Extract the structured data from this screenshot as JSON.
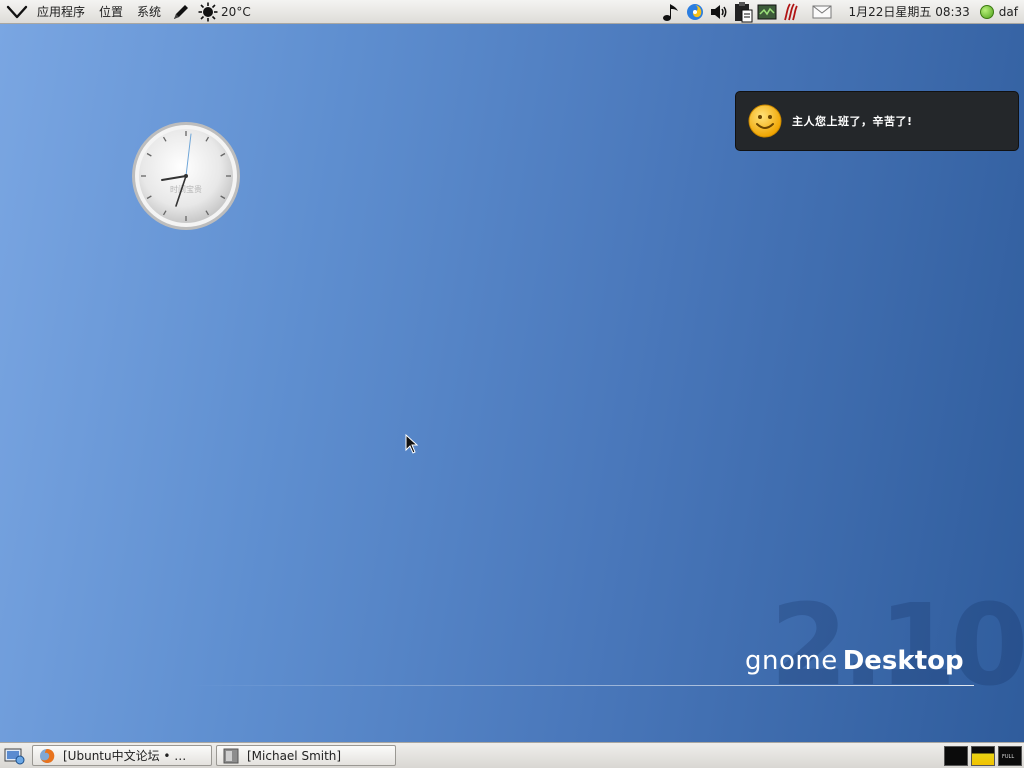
{
  "top_panel": {
    "menus": [
      {
        "label": "应用程序"
      },
      {
        "label": "位置"
      },
      {
        "label": "系统"
      }
    ],
    "weather": {
      "icon": "sun-icon",
      "temperature": "20°C"
    },
    "datetime": "1月22日星期五 08:33",
    "username": "daf",
    "status_color": "#5fb52a"
  },
  "clock_widget": {
    "brand_text": "时间宝贵"
  },
  "notification": {
    "message": "主人您上班了，辛苦了!"
  },
  "branding": {
    "version": "2.10",
    "word1": "gnome",
    "word2": "Desktop"
  },
  "taskbar": {
    "windows": [
      {
        "label": "[Ubuntu中文论坛 • …",
        "icon": "firefox-icon"
      },
      {
        "label": "[Michael Smith]",
        "icon": "terminal-window-icon"
      }
    ]
  },
  "colors": {
    "desktop_light": "#7aa6e2",
    "desktop_dark": "#2f5c9c",
    "notification_bg": "#24272a"
  }
}
